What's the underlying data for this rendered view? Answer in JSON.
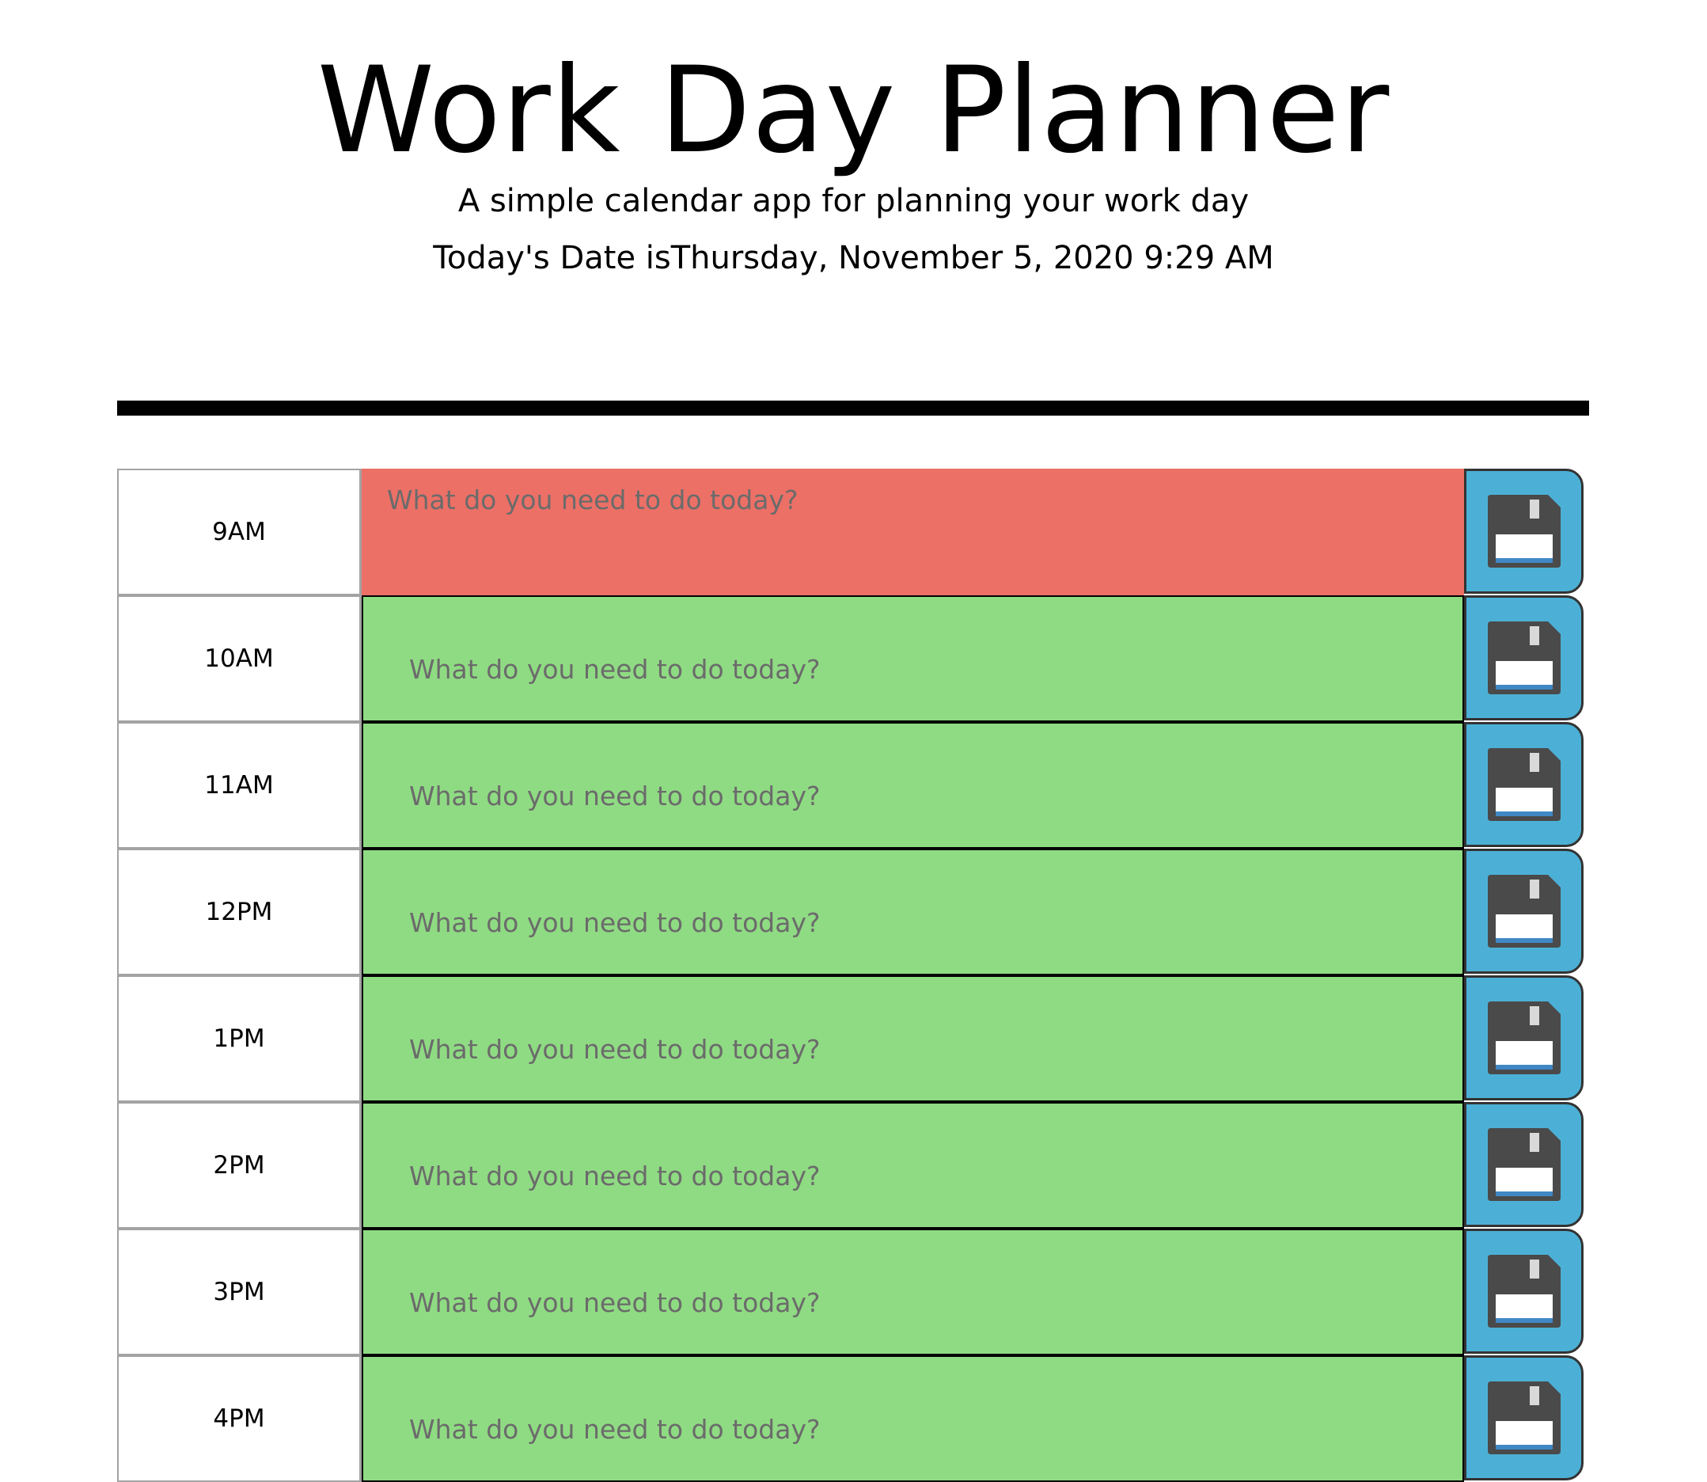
{
  "header": {
    "title": "Work Day Planner",
    "lead": "A simple calendar app for planning your work day",
    "date_text": "Today's Date isThursday, November 5, 2020 9:29 AM"
  },
  "planner": {
    "placeholder": "What do you need to do today?",
    "rows": [
      {
        "hour": "9AM",
        "status": "past"
      },
      {
        "hour": "10AM",
        "status": "future"
      },
      {
        "hour": "11AM",
        "status": "future"
      },
      {
        "hour": "12PM",
        "status": "future"
      },
      {
        "hour": "1PM",
        "status": "future"
      },
      {
        "hour": "2PM",
        "status": "future"
      },
      {
        "hour": "3PM",
        "status": "future"
      },
      {
        "hour": "4PM",
        "status": "future"
      }
    ],
    "save_icon": "floppy-disk-icon"
  },
  "colors": {
    "past": "#ec7066",
    "future": "#8fdb83",
    "save_button": "#4cb0d6"
  }
}
